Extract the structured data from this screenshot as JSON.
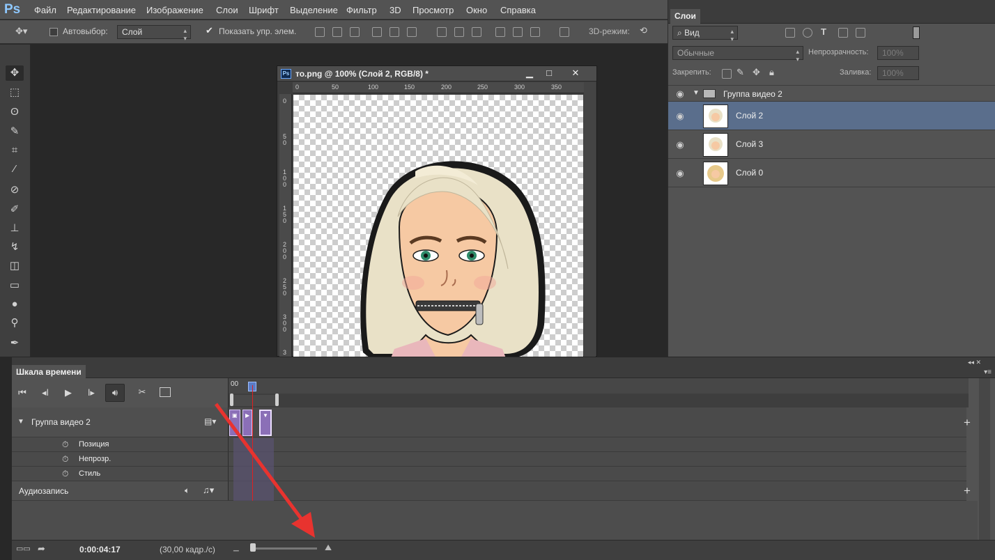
{
  "app": {
    "logo": "Ps"
  },
  "menu": [
    "Файл",
    "Редактирование",
    "Изображение",
    "Слои",
    "Шрифт",
    "Выделение",
    "Фильтр",
    "3D",
    "Просмотр",
    "Окно",
    "Справка"
  ],
  "options": {
    "autoselect_label": "Автовыбор:",
    "autoselect_value": "Слой",
    "show_controls_label": "Показать упр. элем.",
    "mode_3d_label": "3D-режим:"
  },
  "tools": [
    "move-tool",
    "marquee-tool",
    "lasso-tool",
    "quick-selection-tool",
    "crop-tool",
    "eyedropper-tool",
    "healing-brush-tool",
    "brush-tool",
    "clone-stamp-tool",
    "history-brush-tool",
    "eraser-tool",
    "gradient-tool",
    "blur-tool",
    "dodge-tool",
    "pen-tool"
  ],
  "document": {
    "title": "то.png @ 100% (Слой 2, RGB/8) *",
    "ruler_h": [
      "0",
      "50",
      "100",
      "150",
      "200",
      "250",
      "300",
      "350"
    ],
    "ruler_v": [
      "0",
      "5\n0",
      "1\n0\n0",
      "1\n5\n0",
      "2\n0\n0",
      "2\n5\n0",
      "3\n0\n0",
      "3"
    ],
    "min_symbol": "▁",
    "max_symbol": "□",
    "close_symbol": "✕"
  },
  "layers": {
    "tab": "Слои",
    "filter": "Вид",
    "blend_mode": "Обычные",
    "opacity_label": "Непрозрачность:",
    "opacity_value": "100%",
    "lock_label": "Закрепить:",
    "fill_label": "Заливка:",
    "fill_value": "100%",
    "group_name": "Группа видео 2",
    "items": [
      {
        "name": "Слой 2",
        "selected": true
      },
      {
        "name": "Слой 3",
        "selected": false
      },
      {
        "name": "Слой 0",
        "selected": false
      }
    ]
  },
  "timeline": {
    "tab": "Шкала времени",
    "start_label": "00",
    "group_track": "Группа видео 2",
    "sub_tracks": [
      "Позиция",
      "Непрозр.",
      "Стиль"
    ],
    "audio_track": "Аудиозапись",
    "timecode": "0:00:04:17",
    "fps": "(30,00 кадр./с)",
    "add_symbol": "+"
  },
  "colors": {
    "accent": "#5a6e8c",
    "arrow": "#e8332f",
    "clip": "#8b6fb7"
  }
}
